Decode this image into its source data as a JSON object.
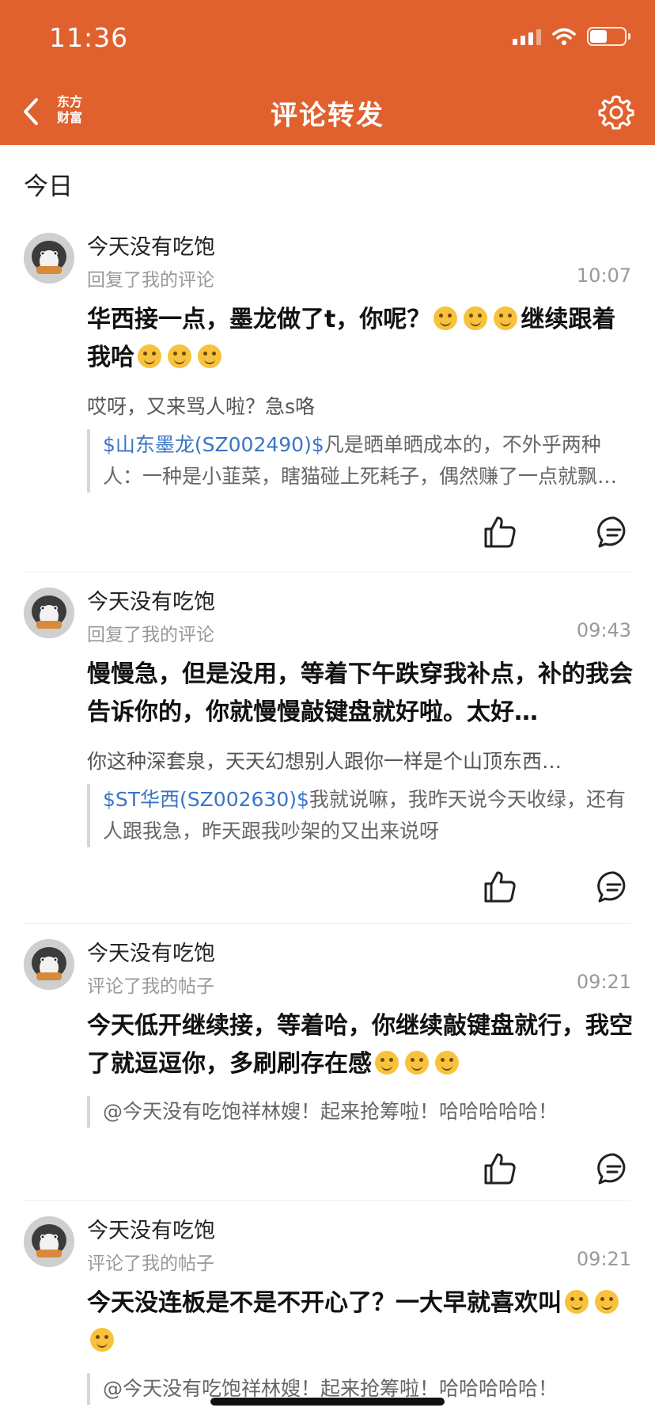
{
  "status_bar": {
    "time": "11:36",
    "battery_level": 0.5
  },
  "nav": {
    "brand": "东方财富",
    "title": "评论转发"
  },
  "section": {
    "title": "今日"
  },
  "colors": {
    "header": "#e0612d",
    "stock_link": "#3a75c4"
  },
  "items": [
    {
      "user": "今天没有吃饱",
      "action": "回复了我的评论",
      "time": "10:07",
      "text_a": "华西接一点，墨龙做了t，你呢？",
      "text_b": "继续跟着我哈",
      "reply": "哎呀，又来骂人啦？急s咯",
      "quote_stock": "$山东墨龙(SZ002490)$",
      "quote_text": "凡是晒单晒成本的，不外乎两种人：一种是小韮菜，瞎猫碰上死耗子，偶然赚了一点就飘了，来股吧炫耀"
    },
    {
      "user": "今天没有吃饱",
      "action": "回复了我的评论",
      "time": "09:43",
      "text": "慢慢急，但是没用，等着下午跌穿我补点，补的我会告诉你的，你就慢慢敲键盘就好啦。太好…",
      "reply": "你这种深套泉，天天幻想别人跟你一样是个山顶东西…",
      "quote_stock": "$ST华西(SZ002630)$",
      "quote_text": "我就说嘛，我昨天说今天收绿，还有人跟我急，昨天跟我吵架的又出来说呀"
    },
    {
      "user": "今天没有吃饱",
      "action": "评论了我的帖子",
      "time": "09:21",
      "text": "今天低开继续接，等着哈，你继续敲键盘就行，我空了就逗逗你，多刷刷存在感",
      "quote_text": "@今天没有吃饱祥林嫂！起来抢筹啦！哈哈哈哈哈！"
    },
    {
      "user": "今天没有吃饱",
      "action": "评论了我的帖子",
      "time": "09:21",
      "text": "今天没连板是不是不开心了？一大早就喜欢叫",
      "quote_text": "@今天没有吃饱祥林嫂！起来抢筹啦！哈哈哈哈哈！"
    }
  ]
}
